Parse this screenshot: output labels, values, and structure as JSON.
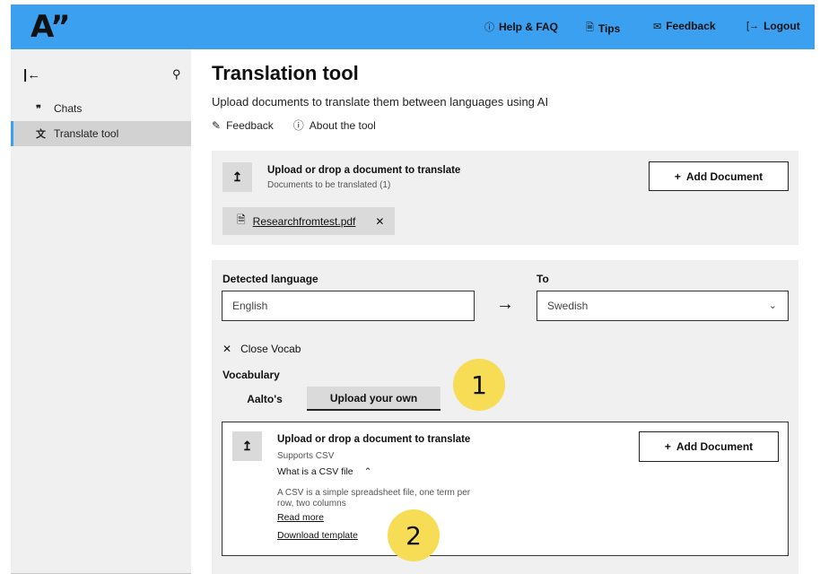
{
  "header": {
    "logo": "A”",
    "nav": [
      {
        "label": "Help & FAQ",
        "icon": "info-icon"
      },
      {
        "label": "Tips",
        "icon": "document-icon"
      },
      {
        "label": "Feedback",
        "icon": "mail-icon"
      },
      {
        "label": "Logout",
        "icon": "logout-icon"
      }
    ]
  },
  "sidebar": {
    "items": [
      {
        "label": "Chats",
        "icon": "quote-icon"
      },
      {
        "label": "Translate tool",
        "icon": "translate-icon",
        "active": true
      }
    ]
  },
  "main": {
    "title": "Translation tool",
    "subtitle": "Upload documents to translate them between languages using AI",
    "links": {
      "feedback": "Feedback",
      "about": "About the tool"
    },
    "upload": {
      "title": "Upload or drop a document to translate",
      "subtitle": "Documents to be translated (1)",
      "add_button": "Add Document",
      "file_name": "Researchfromtest.pdf"
    },
    "languages": {
      "detected_label": "Detected language",
      "detected_value": "English",
      "to_label": "To",
      "to_value": "Swedish"
    },
    "vocab": {
      "close_label": "Close Vocab",
      "heading": "Vocabulary",
      "tabs": [
        "Aalto's",
        "Upload your own"
      ],
      "upload_title": "Upload or drop a document to translate",
      "supports": "Supports CSV",
      "what_is": "What is a CSV file",
      "description": "A CSV is a simple spreadsheet file, one term per row, two columns",
      "read_more": "Read more",
      "download_template": "Download template",
      "add_button": "Add Document"
    }
  },
  "callouts": [
    "1",
    "2"
  ],
  "colors": {
    "accent": "#3ca0f0",
    "panel": "#f0f0f0",
    "callout": "#f7dc55"
  }
}
